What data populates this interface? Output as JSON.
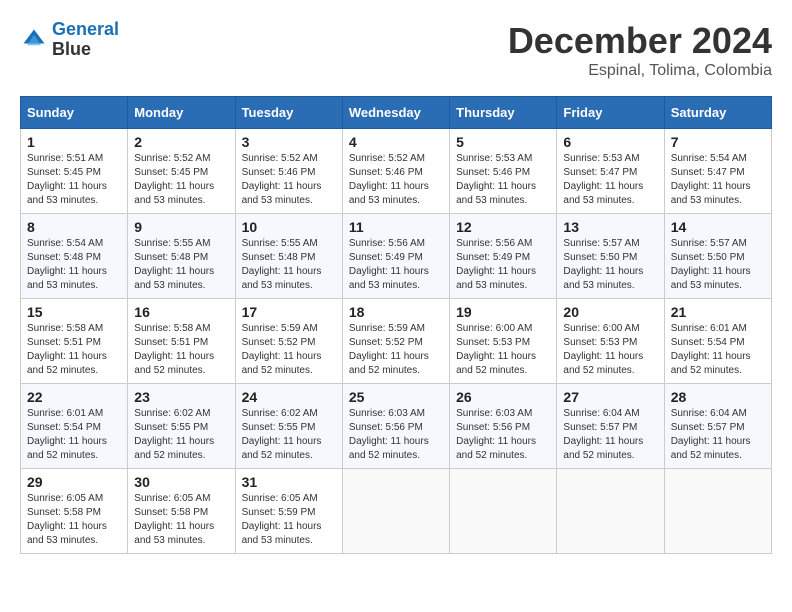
{
  "header": {
    "logo_line1": "General",
    "logo_line2": "Blue",
    "month_title": "December 2024",
    "location": "Espinal, Tolima, Colombia"
  },
  "days_of_week": [
    "Sunday",
    "Monday",
    "Tuesday",
    "Wednesday",
    "Thursday",
    "Friday",
    "Saturday"
  ],
  "weeks": [
    [
      {
        "day": "1",
        "sunrise": "5:51 AM",
        "sunset": "5:45 PM",
        "daylight": "11 hours and 53 minutes."
      },
      {
        "day": "2",
        "sunrise": "5:52 AM",
        "sunset": "5:45 PM",
        "daylight": "11 hours and 53 minutes."
      },
      {
        "day": "3",
        "sunrise": "5:52 AM",
        "sunset": "5:46 PM",
        "daylight": "11 hours and 53 minutes."
      },
      {
        "day": "4",
        "sunrise": "5:52 AM",
        "sunset": "5:46 PM",
        "daylight": "11 hours and 53 minutes."
      },
      {
        "day": "5",
        "sunrise": "5:53 AM",
        "sunset": "5:46 PM",
        "daylight": "11 hours and 53 minutes."
      },
      {
        "day": "6",
        "sunrise": "5:53 AM",
        "sunset": "5:47 PM",
        "daylight": "11 hours and 53 minutes."
      },
      {
        "day": "7",
        "sunrise": "5:54 AM",
        "sunset": "5:47 PM",
        "daylight": "11 hours and 53 minutes."
      }
    ],
    [
      {
        "day": "8",
        "sunrise": "5:54 AM",
        "sunset": "5:48 PM",
        "daylight": "11 hours and 53 minutes."
      },
      {
        "day": "9",
        "sunrise": "5:55 AM",
        "sunset": "5:48 PM",
        "daylight": "11 hours and 53 minutes."
      },
      {
        "day": "10",
        "sunrise": "5:55 AM",
        "sunset": "5:48 PM",
        "daylight": "11 hours and 53 minutes."
      },
      {
        "day": "11",
        "sunrise": "5:56 AM",
        "sunset": "5:49 PM",
        "daylight": "11 hours and 53 minutes."
      },
      {
        "day": "12",
        "sunrise": "5:56 AM",
        "sunset": "5:49 PM",
        "daylight": "11 hours and 53 minutes."
      },
      {
        "day": "13",
        "sunrise": "5:57 AM",
        "sunset": "5:50 PM",
        "daylight": "11 hours and 53 minutes."
      },
      {
        "day": "14",
        "sunrise": "5:57 AM",
        "sunset": "5:50 PM",
        "daylight": "11 hours and 53 minutes."
      }
    ],
    [
      {
        "day": "15",
        "sunrise": "5:58 AM",
        "sunset": "5:51 PM",
        "daylight": "11 hours and 52 minutes."
      },
      {
        "day": "16",
        "sunrise": "5:58 AM",
        "sunset": "5:51 PM",
        "daylight": "11 hours and 52 minutes."
      },
      {
        "day": "17",
        "sunrise": "5:59 AM",
        "sunset": "5:52 PM",
        "daylight": "11 hours and 52 minutes."
      },
      {
        "day": "18",
        "sunrise": "5:59 AM",
        "sunset": "5:52 PM",
        "daylight": "11 hours and 52 minutes."
      },
      {
        "day": "19",
        "sunrise": "6:00 AM",
        "sunset": "5:53 PM",
        "daylight": "11 hours and 52 minutes."
      },
      {
        "day": "20",
        "sunrise": "6:00 AM",
        "sunset": "5:53 PM",
        "daylight": "11 hours and 52 minutes."
      },
      {
        "day": "21",
        "sunrise": "6:01 AM",
        "sunset": "5:54 PM",
        "daylight": "11 hours and 52 minutes."
      }
    ],
    [
      {
        "day": "22",
        "sunrise": "6:01 AM",
        "sunset": "5:54 PM",
        "daylight": "11 hours and 52 minutes."
      },
      {
        "day": "23",
        "sunrise": "6:02 AM",
        "sunset": "5:55 PM",
        "daylight": "11 hours and 52 minutes."
      },
      {
        "day": "24",
        "sunrise": "6:02 AM",
        "sunset": "5:55 PM",
        "daylight": "11 hours and 52 minutes."
      },
      {
        "day": "25",
        "sunrise": "6:03 AM",
        "sunset": "5:56 PM",
        "daylight": "11 hours and 52 minutes."
      },
      {
        "day": "26",
        "sunrise": "6:03 AM",
        "sunset": "5:56 PM",
        "daylight": "11 hours and 52 minutes."
      },
      {
        "day": "27",
        "sunrise": "6:04 AM",
        "sunset": "5:57 PM",
        "daylight": "11 hours and 52 minutes."
      },
      {
        "day": "28",
        "sunrise": "6:04 AM",
        "sunset": "5:57 PM",
        "daylight": "11 hours and 52 minutes."
      }
    ],
    [
      {
        "day": "29",
        "sunrise": "6:05 AM",
        "sunset": "5:58 PM",
        "daylight": "11 hours and 53 minutes."
      },
      {
        "day": "30",
        "sunrise": "6:05 AM",
        "sunset": "5:58 PM",
        "daylight": "11 hours and 53 minutes."
      },
      {
        "day": "31",
        "sunrise": "6:05 AM",
        "sunset": "5:59 PM",
        "daylight": "11 hours and 53 minutes."
      },
      null,
      null,
      null,
      null
    ]
  ]
}
